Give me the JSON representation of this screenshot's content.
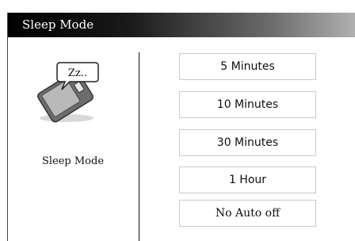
{
  "dialog": {
    "title": "Sleep Mode"
  },
  "left_panel": {
    "icon": "sleeping-device-icon",
    "bubble_text": "Zz..",
    "label": "Sleep Mode"
  },
  "options": [
    {
      "label": "5 Minutes"
    },
    {
      "label": "10 Minutes"
    },
    {
      "label": "30 Minutes"
    },
    {
      "label": "1 Hour"
    },
    {
      "label": "No Auto off"
    }
  ]
}
